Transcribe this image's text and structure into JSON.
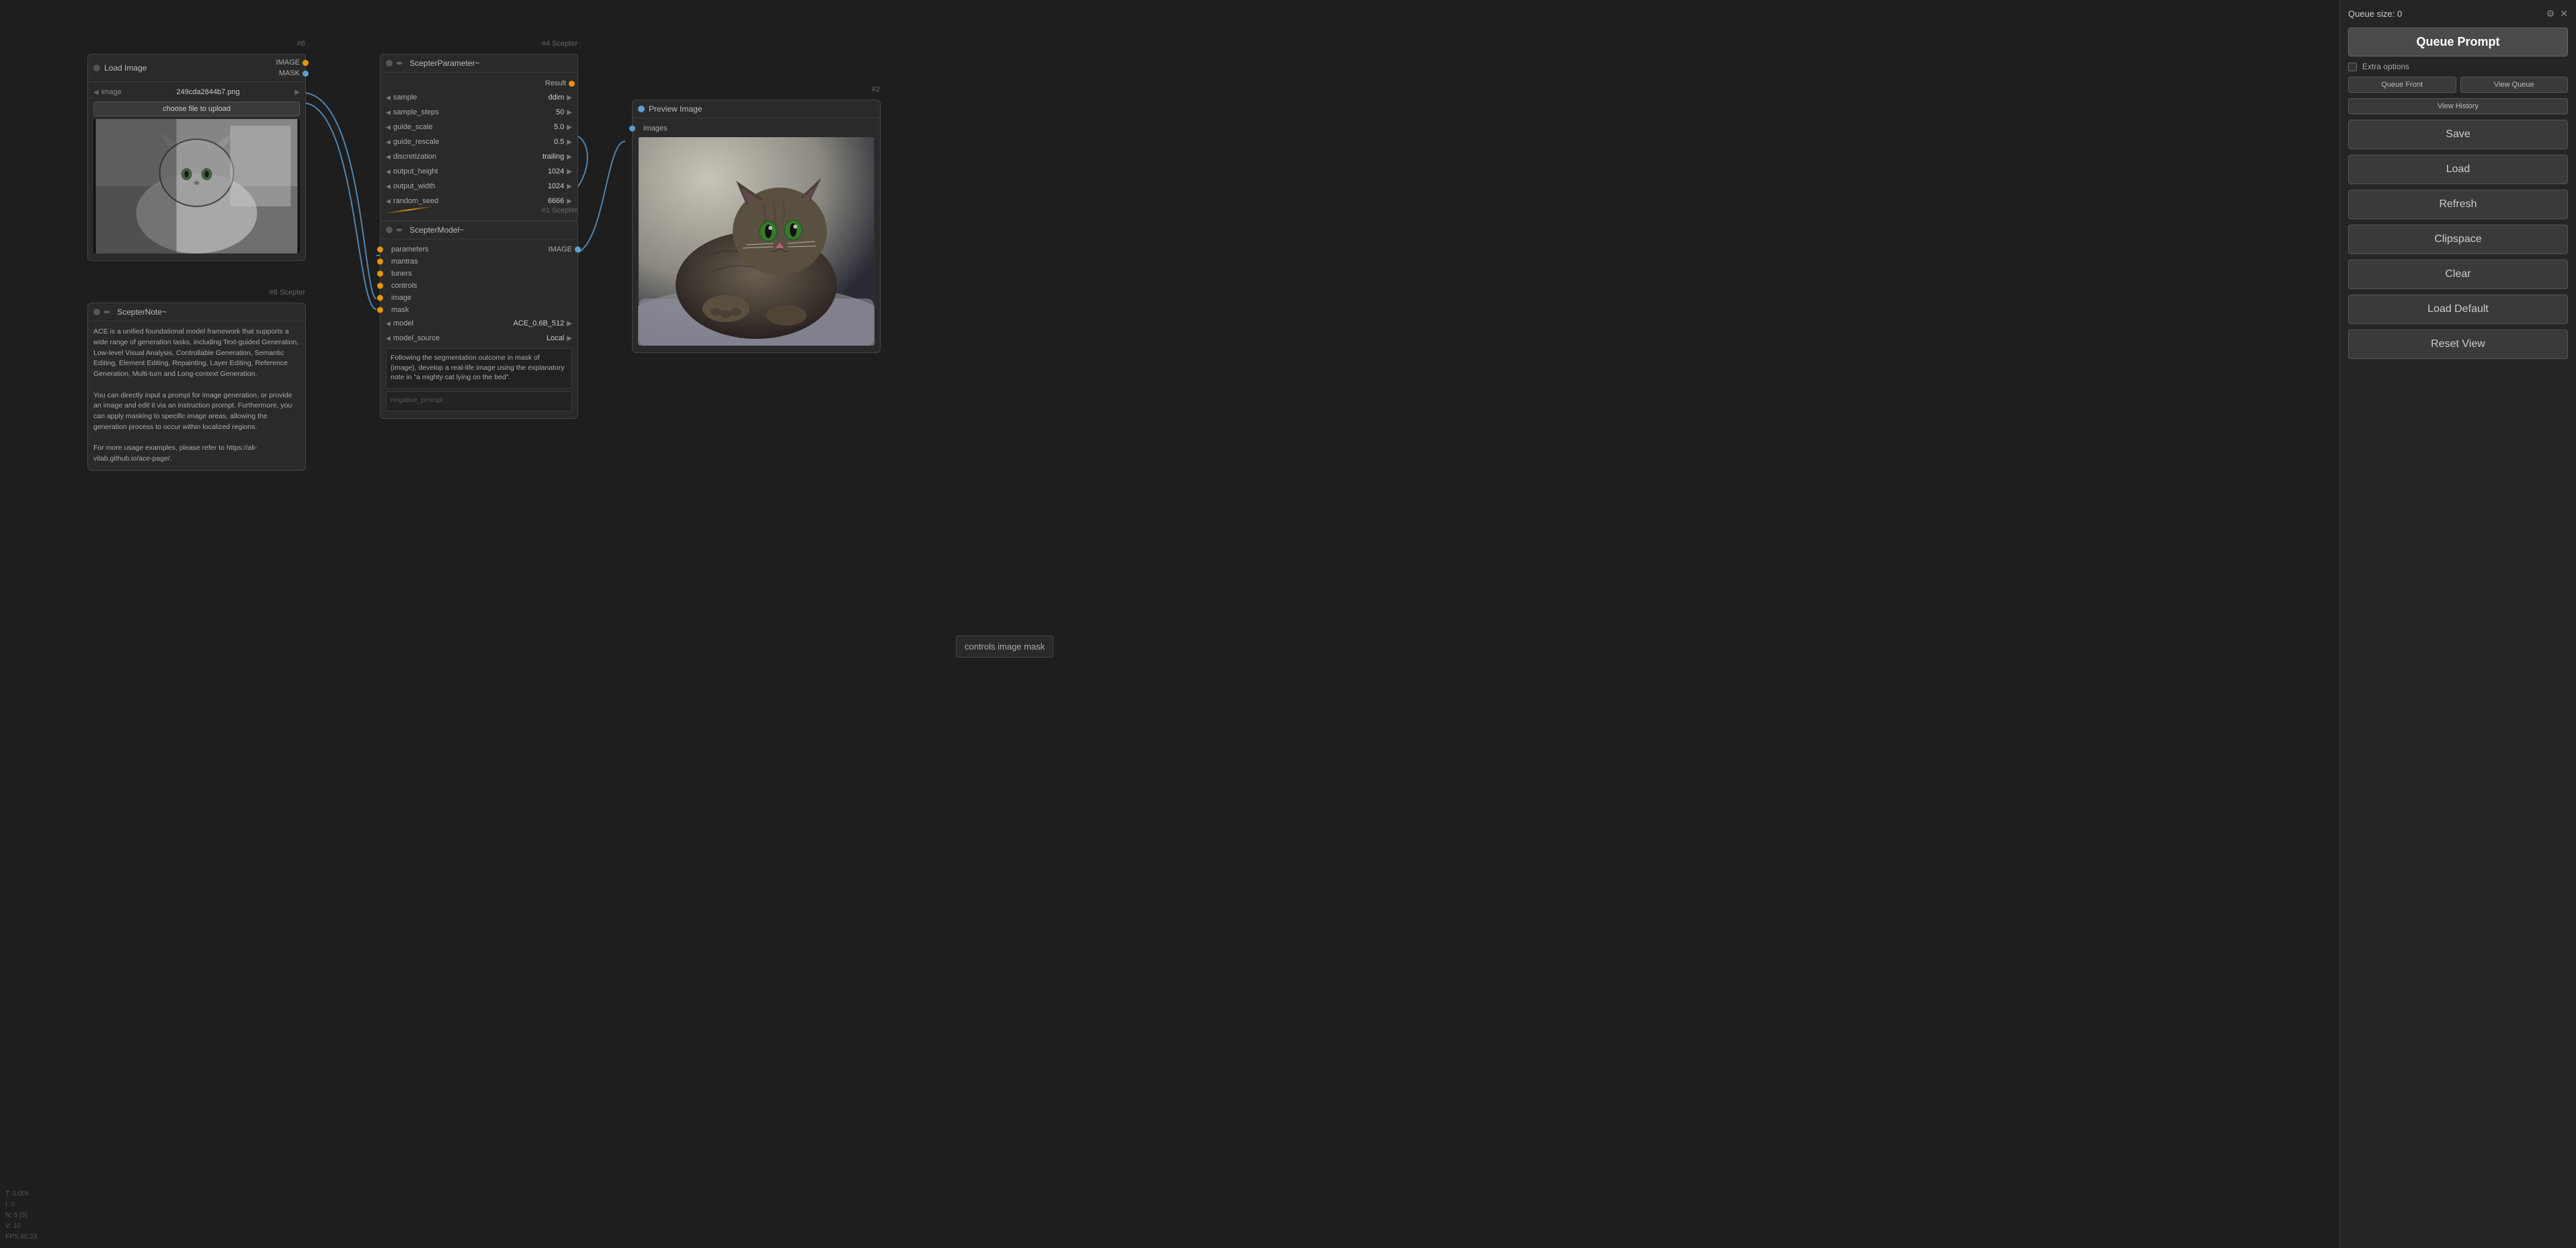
{
  "canvas": {
    "background": "#1e1e1e"
  },
  "nodes": {
    "load_image": {
      "id": "#6",
      "title": "Load Image",
      "outputs": [
        "IMAGE",
        "MASK"
      ],
      "file_name": "249cda2844b7.png",
      "upload_btn": "choose file to upload"
    },
    "scepter_note": {
      "id": "#8 Scepter",
      "title": "ScepterNote~",
      "text": "ACE is a unified foundational model framework that supports a wide range of generation tasks, including Text-guided Generation, Low-level Visual Analysis, Controllable Generation, Semantic Editing, Element Editing, Repainting, Layer Editing, Reference Generation, Multi-turn and Long-context Generation.\n\nYou can directly input a prompt for image generation, or provide an image and edit it via an instruction prompt. Furthermore, you can apply masking to specific image areas, allowing the generation process to occur within localized regions.\n\nFor more usage examples, please refer to https://ali-vilab.github.io/ace-page/."
    },
    "scepter_parameter": {
      "id": "#4 Scepter",
      "title": "ScepterParameter~",
      "result_label": "Result",
      "params": [
        {
          "name": "sample",
          "value": "ddim"
        },
        {
          "name": "sample_steps",
          "value": "50"
        },
        {
          "name": "guide_scale",
          "value": "5.0"
        },
        {
          "name": "guide_rescale",
          "value": "0.5"
        },
        {
          "name": "discretization",
          "value": "trailing"
        },
        {
          "name": "output_height",
          "value": "1024"
        },
        {
          "name": "output_width",
          "value": "1024"
        },
        {
          "name": "random_seed",
          "value": "6666"
        }
      ]
    },
    "scepter_model": {
      "id": "#1 Scepter",
      "title": "ScepterModel~",
      "inputs": [
        "parameters",
        "mantras",
        "tuners",
        "controls",
        "image",
        "mask"
      ],
      "output": "IMAGE",
      "params": [
        {
          "name": "model",
          "value": "ACE_0.6B_512"
        },
        {
          "name": "model_source",
          "value": "Local"
        }
      ],
      "prompt": "Following the segmentation outcome in mask of {image}, develop a real-life image using the explanatory note in \"a mighty cat lying on the bed\".",
      "neg_prompt": "negative_prompt"
    },
    "preview_image": {
      "id": "#2",
      "title": "Preview Image",
      "input": "images"
    }
  },
  "right_panel": {
    "queue_size_label": "Queue size: 0",
    "queue_prompt_btn": "Queue Prompt",
    "extra_options_label": "Extra options",
    "queue_front_btn": "Queue Front",
    "view_queue_btn": "View Queue",
    "view_history_btn": "View History",
    "save_btn": "Save",
    "load_btn": "Load",
    "refresh_btn": "Refresh",
    "clipspace_btn": "Clipspace",
    "clear_btn": "Clear",
    "load_default_btn": "Load Default",
    "reset_view_btn": "Reset View"
  },
  "status_bar": {
    "t": "T: 0.00s",
    "i": "I: 0",
    "n": "N: 5 [5]",
    "v": "V: 10",
    "fps": "FPS:60.24"
  },
  "controls_image_mask_label": "controls image mask"
}
